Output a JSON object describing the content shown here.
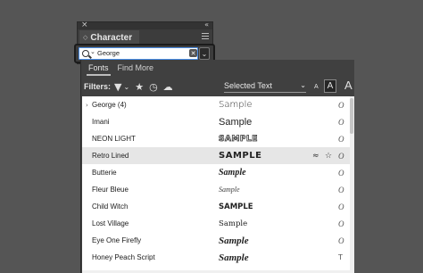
{
  "panel": {
    "tab_label": "Character"
  },
  "search": {
    "value": "George",
    "clear_glyph": "✕",
    "dropdown_glyph": "⌄"
  },
  "tabs": [
    "Fonts",
    "Find More"
  ],
  "filters": {
    "label": "Filters:",
    "icons": [
      "filter-icon",
      "star-icon",
      "recent-icon",
      "sync-cloud-icon"
    ]
  },
  "preview": {
    "label": "Selected Text",
    "size_small": "A",
    "size_medium": "A",
    "size_large": "A"
  },
  "fonts": [
    {
      "name": "George (4)",
      "sample": "Sample",
      "type_glyph": "O",
      "expandable": true
    },
    {
      "name": "Imani",
      "sample": "Sample",
      "type_glyph": "O"
    },
    {
      "name": "NEON LIGHT",
      "sample": "SAMPLE",
      "type_glyph": "O"
    },
    {
      "name": "Retro Lined",
      "sample": "SAMPLE",
      "type_glyph": "O",
      "highlighted": true,
      "extra": [
        "≈",
        "☆"
      ]
    },
    {
      "name": "Butterie",
      "sample": "Sample",
      "type_glyph": "O"
    },
    {
      "name": "Fleur Bleue",
      "sample": "Sample",
      "type_glyph": "O"
    },
    {
      "name": "Child Witch",
      "sample": "SAMPLE",
      "type_glyph": "O"
    },
    {
      "name": "Lost Village",
      "sample": "Sample",
      "type_glyph": "O"
    },
    {
      "name": "Eye One Firefly",
      "sample": "Sample",
      "type_glyph": "O"
    },
    {
      "name": "Honey Peach Script",
      "sample": "Sample",
      "type_glyph": "T"
    }
  ],
  "colors": {
    "focus_blue": "#4b8fe8",
    "row_highlight": "#e6e6e6",
    "panel_dark": "#3c3c3c",
    "background": "#555555"
  }
}
